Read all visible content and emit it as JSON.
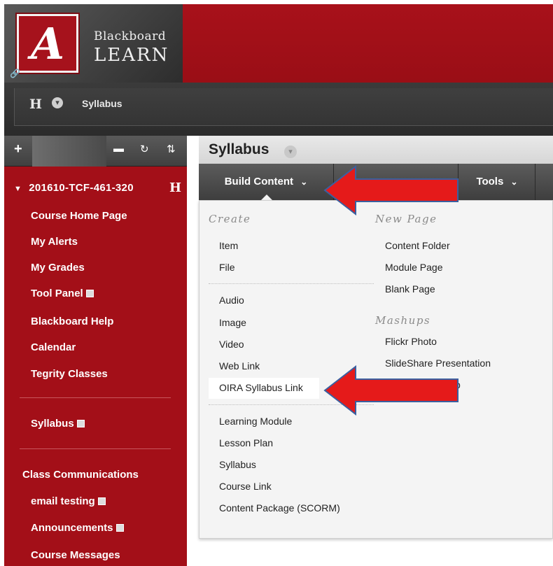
{
  "header": {
    "logo_letter": "A",
    "brand_line1": "Blackboard",
    "brand_line2": "LEARN"
  },
  "breadcrumb": {
    "home_label": "H",
    "title": "Syllabus"
  },
  "sidebar": {
    "course_id": "201610-TCF-461-320",
    "course_badge": "H",
    "items": [
      {
        "label": "Course Home Page"
      },
      {
        "label": "My Alerts"
      },
      {
        "label": "My Grades"
      },
      {
        "label": "Tool Panel"
      },
      {
        "label": "Blackboard Help"
      },
      {
        "label": "Calendar"
      },
      {
        "label": "Tegrity Classes"
      }
    ],
    "syllabus_label": "Syllabus",
    "section_heading": "Class Communications",
    "comm_items": [
      {
        "label": "email testing"
      },
      {
        "label": "Announcements"
      },
      {
        "label": "Course Messages"
      }
    ]
  },
  "main": {
    "title": "Syllabus",
    "toolbar": {
      "build_content": "Build Content",
      "tools": "Tools"
    },
    "menu": {
      "create_heading": "Create",
      "create_items": [
        "Item",
        "File"
      ],
      "media_items": [
        "Audio",
        "Image",
        "Video",
        "Web Link",
        "OIRA Syllabus Link"
      ],
      "learning_items": [
        "Learning Module",
        "Lesson Plan",
        "Syllabus",
        "Course Link",
        "Content Package (SCORM)"
      ],
      "new_page_heading": "New Page",
      "new_page_items": [
        "Content Folder",
        "Module Page",
        "Blank Page"
      ],
      "mashups_heading": "Mashups",
      "mashup_items": [
        "Flickr Photo",
        "SlideShare Presentation"
      ],
      "hidden_partial": "p"
    }
  },
  "colors": {
    "brand_red": "#a30f18",
    "arrow_red": "#e51a1a",
    "arrow_outline": "#3a5fa0"
  }
}
